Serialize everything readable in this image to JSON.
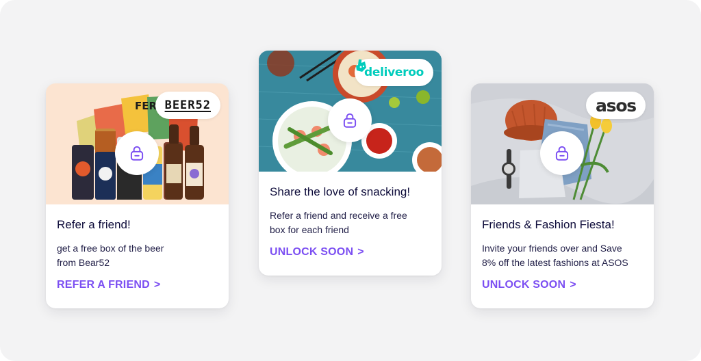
{
  "cards": [
    {
      "brand": "BEER52",
      "title": "Refer a friend!",
      "description_lines": [
        "get a free box of the beer",
        "from Bear52"
      ],
      "cta": "REFER A FRIEND",
      "chevron": ">",
      "hero_icon": "beer-cans-image",
      "lock_icon": "lock-icon"
    },
    {
      "brand": "deliveroo",
      "title": "Share the love of snacking!",
      "description_lines": [
        "Refer a friend and receive a free",
        "box for each friend"
      ],
      "cta": "UNLOCK SOON",
      "chevron": ">",
      "hero_icon": "food-bowls-image",
      "lock_icon": "lock-icon"
    },
    {
      "brand": "asos",
      "title": "Friends & Fashion Fiesta!",
      "description_lines": [
        "Invite your friends over and Save",
        "8% off the latest fashions at ASOS"
      ],
      "cta": "UNLOCK SOON",
      "chevron": ">",
      "hero_icon": "fashion-items-image",
      "lock_icon": "lock-icon"
    }
  ],
  "colors": {
    "accent": "#7b4ef2",
    "title": "#0f0d3b",
    "background": "#f3f3f4",
    "deliveroo": "#00ccbc"
  }
}
